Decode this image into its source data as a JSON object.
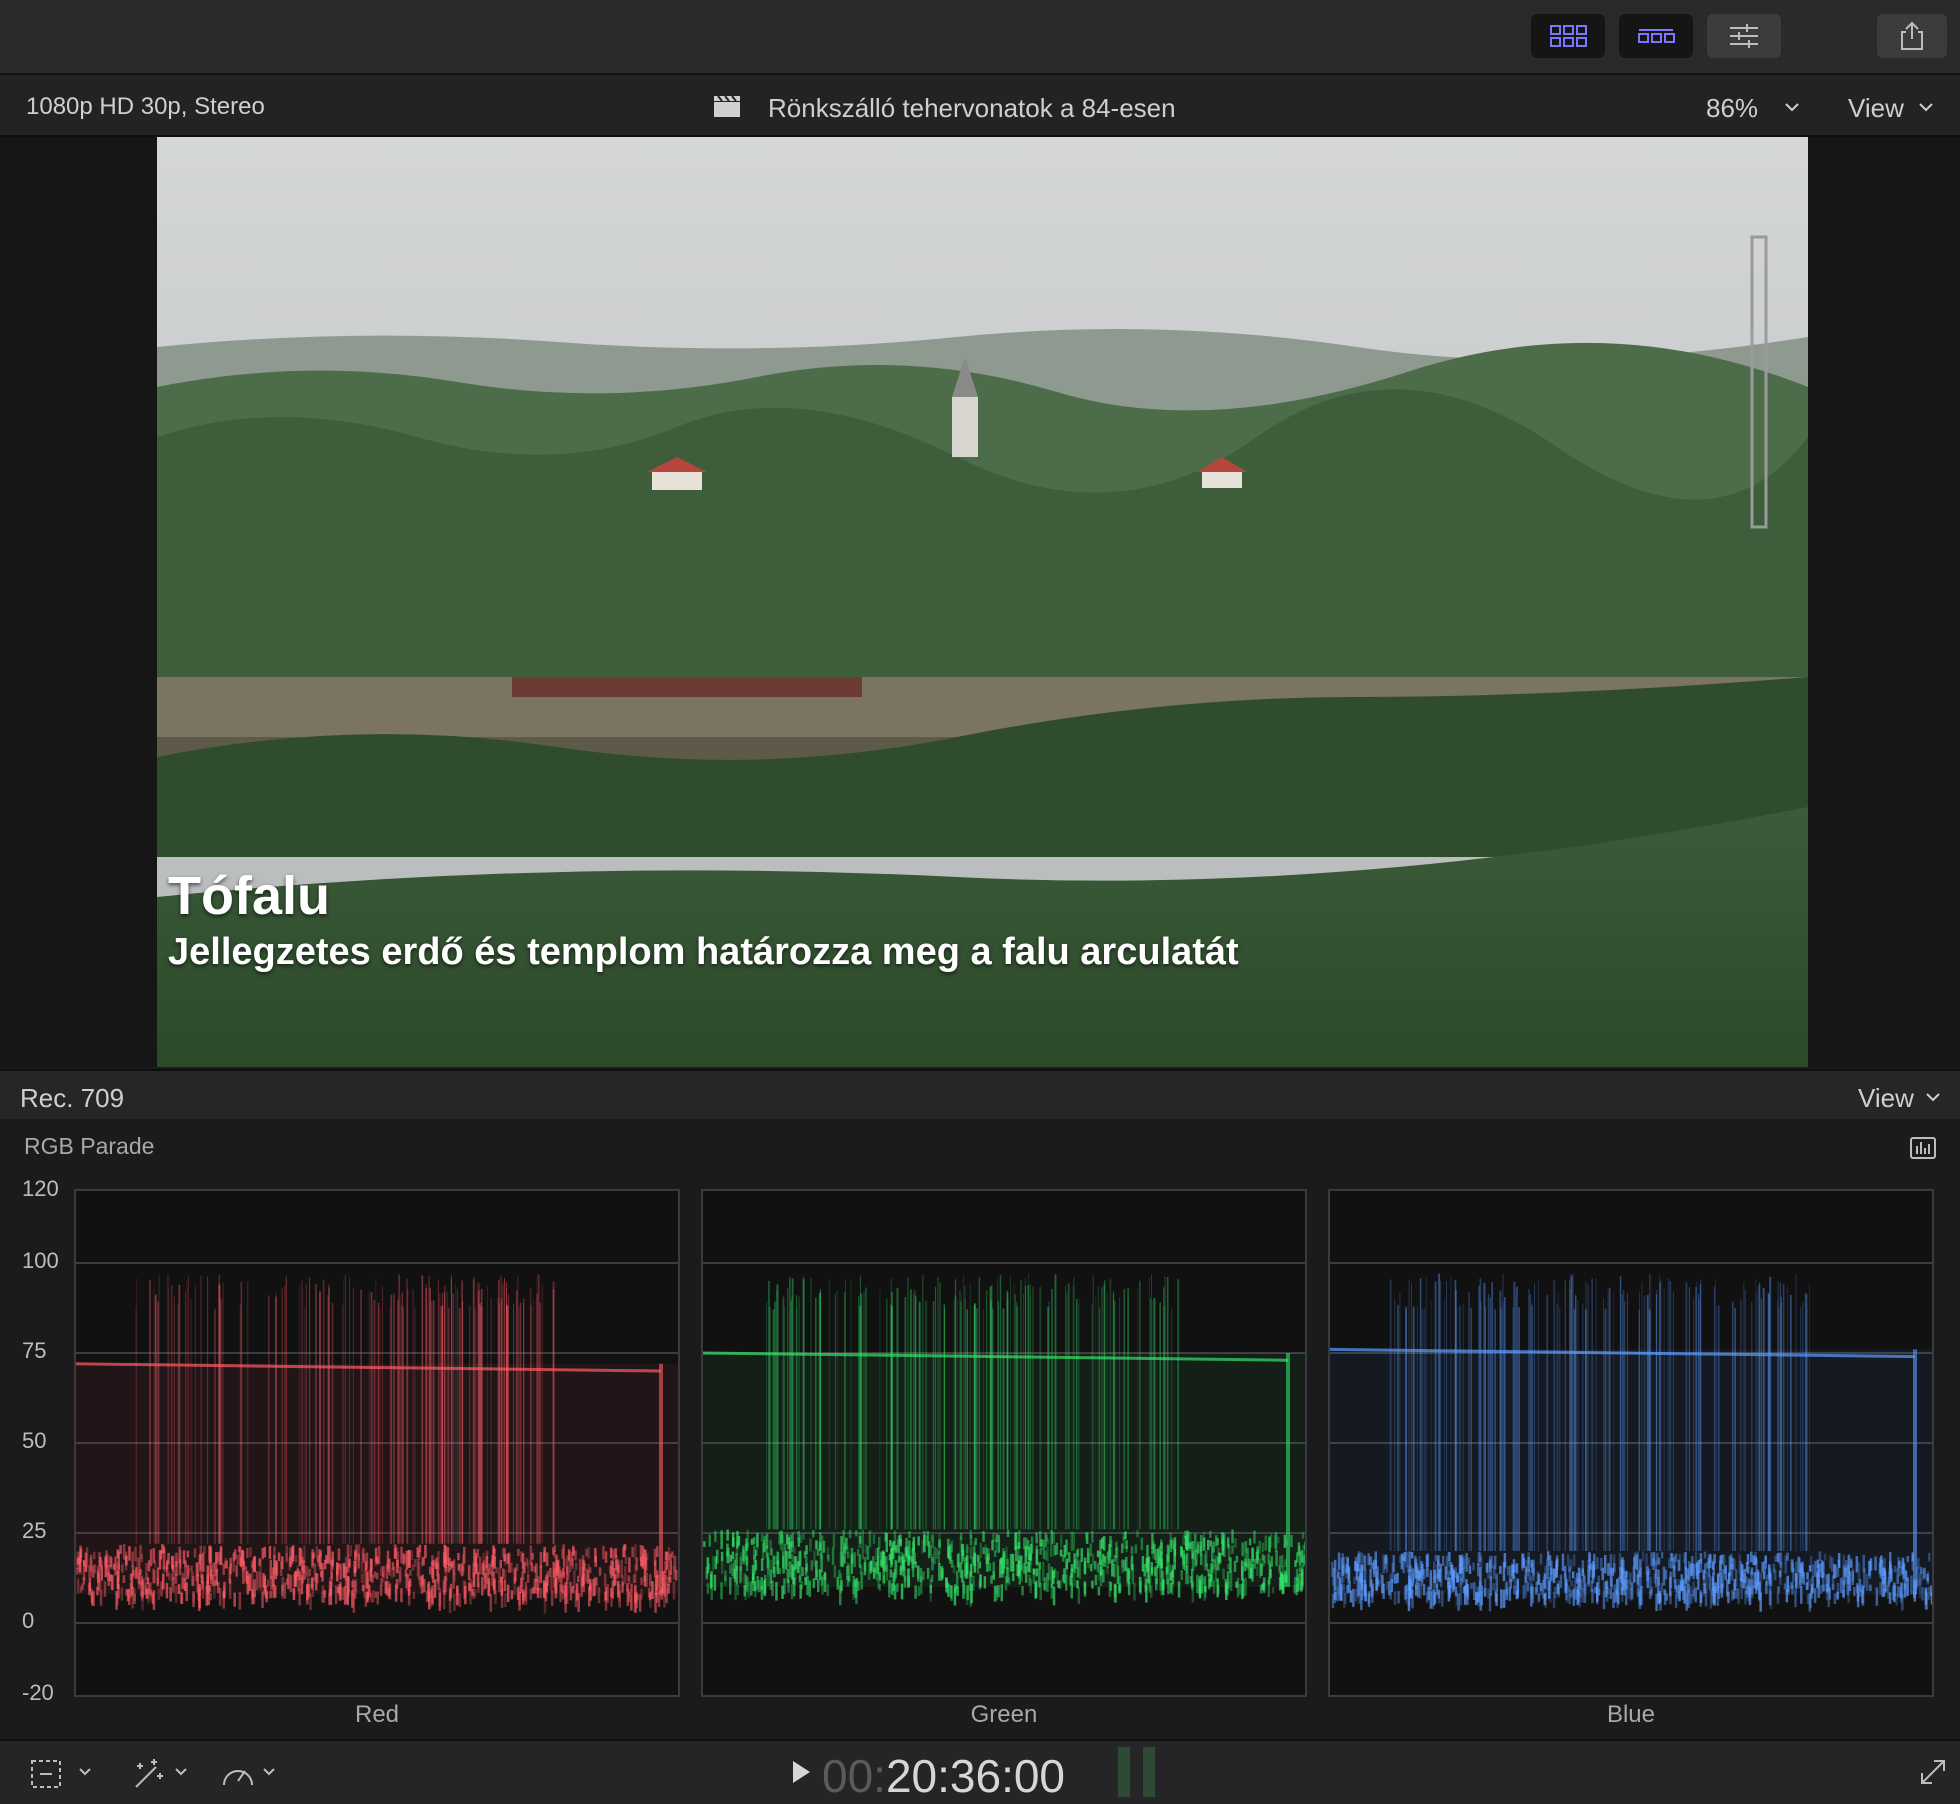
{
  "viewer": {
    "format": "1080p HD 30p, Stereo",
    "project_title": "Rönkszálló tehervonatok a 84-esen",
    "zoom": "86%",
    "view_label": "View",
    "title_overlay": "Tófalu",
    "subtitle_overlay": "Jellegzetes erdő és templom határozza meg a falu arculatát"
  },
  "scopes": {
    "colorspace": "Rec. 709",
    "view_label": "View",
    "scope_type": "RGB Parade",
    "y_ticks": [
      "120",
      "100",
      "75",
      "50",
      "25",
      "0",
      "-20"
    ],
    "panels": [
      {
        "name": "Red",
        "color": "#ff5c66"
      },
      {
        "name": "Green",
        "color": "#34e36a"
      },
      {
        "name": "Blue",
        "color": "#5b9bff"
      }
    ]
  },
  "chart_data": {
    "type": "scatter",
    "ylim": [
      -20,
      120
    ],
    "y_ticks": [
      120,
      100,
      75,
      50,
      25,
      0,
      -20
    ],
    "series": [
      {
        "name": "Red",
        "band_low": 8,
        "band_high": 22,
        "highlight": 72,
        "peak": 97
      },
      {
        "name": "Green",
        "band_low": 10,
        "band_high": 26,
        "highlight": 75,
        "peak": 97
      },
      {
        "name": "Blue",
        "band_low": 8,
        "band_high": 20,
        "highlight": 76,
        "peak": 97
      }
    ],
    "categories": [
      "Red",
      "Green",
      "Blue"
    ]
  },
  "transport": {
    "timecode_dim": "00:",
    "timecode": "20:36:00"
  },
  "colors": {
    "accent": "#7b78ff",
    "background": "#1b1b1d"
  }
}
